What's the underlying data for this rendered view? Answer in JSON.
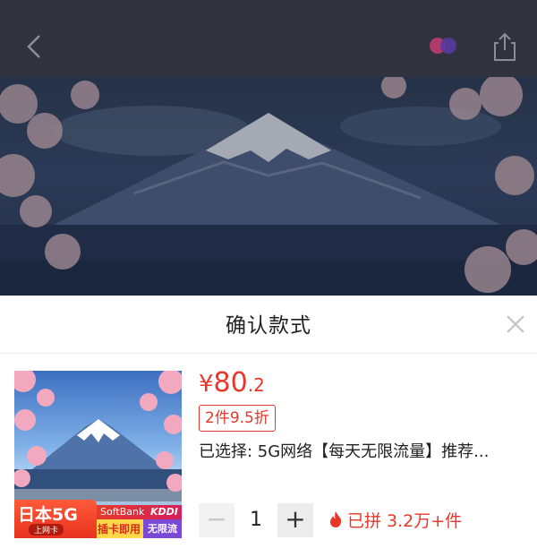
{
  "header": {
    "back_icon": "chevron-left-icon",
    "share_icon": "share-icon",
    "colors": {
      "topbar": "#3b3e4c"
    }
  },
  "sheet": {
    "title": "确认款式",
    "close_icon": "close-icon"
  },
  "product": {
    "thumbnail": {
      "badge_main": "日本5G",
      "badge_sub": "上网卡",
      "brand_1": "SoftBank",
      "brand_2": "KDDI",
      "tag_1": "插卡即用",
      "tag_2": "无限流量"
    },
    "price_symbol": "¥",
    "price_integer": "80",
    "price_decimal": ".2",
    "promo": "2件9.5折",
    "selected_text": "已选择: 5G网络【每天无限流量】推荐...",
    "quantity": "1",
    "minus_label": "−",
    "plus_label": "+",
    "sold_text": "已拼 3.2万+件",
    "accent_color": "#e8362a"
  }
}
